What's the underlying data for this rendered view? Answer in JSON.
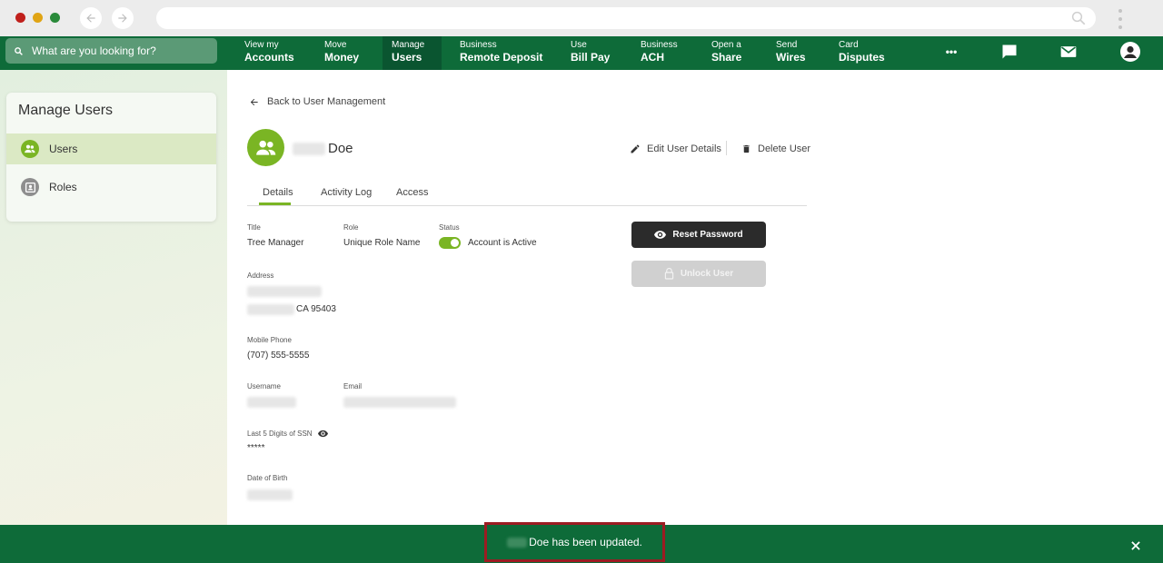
{
  "search": {
    "placeholder": "What are you looking for?"
  },
  "nav": {
    "items": [
      {
        "small": "View my",
        "big": "Accounts"
      },
      {
        "small": "Move",
        "big": "Money"
      },
      {
        "small": "Manage",
        "big": "Users"
      },
      {
        "small": "Business",
        "big": "Remote Deposit"
      },
      {
        "small": "Use",
        "big": "Bill Pay"
      },
      {
        "small": "Business",
        "big": "ACH"
      },
      {
        "small": "Open a",
        "big": "Share"
      },
      {
        "small": "Send",
        "big": "Wires"
      },
      {
        "small": "Card",
        "big": "Disputes"
      }
    ],
    "active_index": 2,
    "more_label": "•••"
  },
  "sidebar": {
    "title": "Manage Users",
    "items": [
      {
        "label": "Users",
        "active": true
      },
      {
        "label": "Roles",
        "active": false
      }
    ]
  },
  "main": {
    "back_label": "Back to User Management",
    "user_last_name": "Doe",
    "edit_label": "Edit User Details",
    "delete_label": "Delete User",
    "tabs": [
      {
        "label": "Details",
        "active": true
      },
      {
        "label": "Activity Log",
        "active": false
      },
      {
        "label": "Access",
        "active": false
      }
    ],
    "fields": {
      "title_label": "Title",
      "title_value": "Tree Manager",
      "role_label": "Role",
      "role_value": "Unique Role Name",
      "status_label": "Status",
      "status_value": "Account is Active",
      "address_label": "Address",
      "address_city_suffix": "CA 95403",
      "mobile_label": "Mobile Phone",
      "mobile_value": "(707) 555-5555",
      "username_label": "Username",
      "email_label": "Email",
      "ssn_label": "Last 5 Digits of SSN",
      "ssn_value": "*****",
      "dob_label": "Date of Birth"
    },
    "reset_label": "Reset Password",
    "unlock_label": "Unlock User"
  },
  "toast": {
    "message": "Doe has been updated.",
    "close_label": "✕"
  },
  "colors": {
    "brand_green": "#0e6b39",
    "accent_green": "#7ab524",
    "highlight_border": "#9c1c22"
  }
}
